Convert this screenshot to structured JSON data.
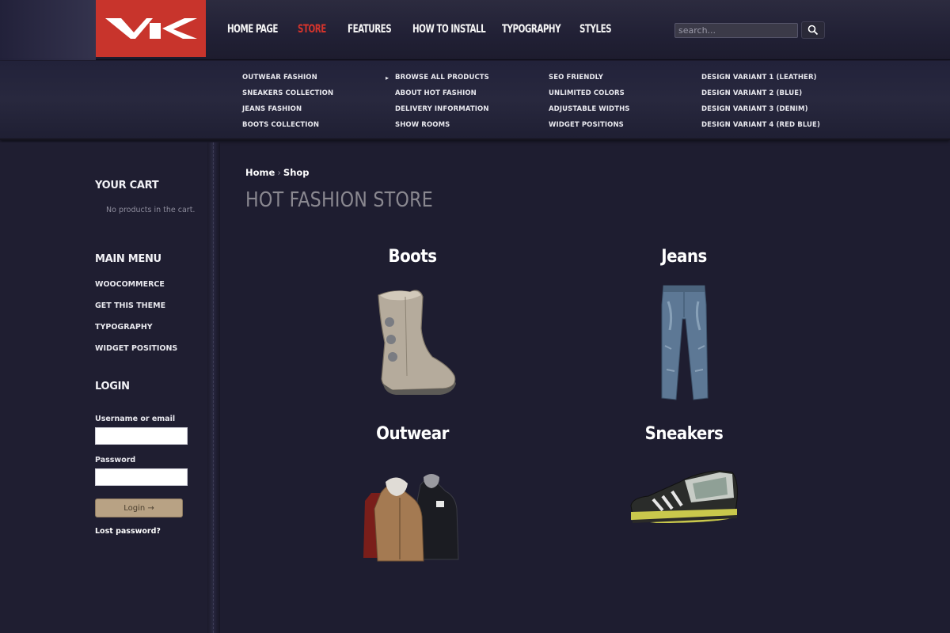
{
  "logo": {
    "text": "VK"
  },
  "nav": {
    "items": [
      "Home Page",
      "Store",
      "Features",
      "How to Install",
      "Typography",
      "Styles"
    ],
    "active": "Store"
  },
  "search": {
    "placeholder": "search..."
  },
  "mega_menu": {
    "col1": [
      "Outwear Fashion",
      "Sneakers Collection",
      "Jeans Fashion",
      "Boots Collection"
    ],
    "col2": [
      "Browse All Products",
      "About Hot Fashion",
      "Delivery Information",
      "Show Rooms"
    ],
    "col3": [
      "SEO Friendly",
      "Unlimited Colors",
      "Adjustable Widths",
      "Widget Positions"
    ],
    "col4": [
      "Design Variant 1 (Leather)",
      "Design Variant 2 (Blue)",
      "Design Variant 3 (Denim)",
      "Design Variant 4 (Red Blue)"
    ]
  },
  "sidebar": {
    "cart_heading": "Your Cart",
    "cart_empty": "No products in the cart.",
    "menu_heading": "Main Menu",
    "menu_items": [
      "WooCommerce",
      "Get This Theme",
      "Typography",
      "Widget Positions"
    ],
    "login_heading": "Login",
    "username_label": "Username or email",
    "password_label": "Password",
    "login_button": "Login →",
    "lost_password": "Lost password?"
  },
  "main": {
    "breadcrumb": [
      "Home",
      "Shop"
    ],
    "breadcrumb_sep": "›",
    "title": "HOT FASHION STORE",
    "categories": [
      "Boots",
      "Jeans",
      "Outwear",
      "Sneakers"
    ]
  },
  "colors": {
    "accent_red": "#c8342c",
    "background": "#1e1d30",
    "login_button": "#b8a284"
  }
}
